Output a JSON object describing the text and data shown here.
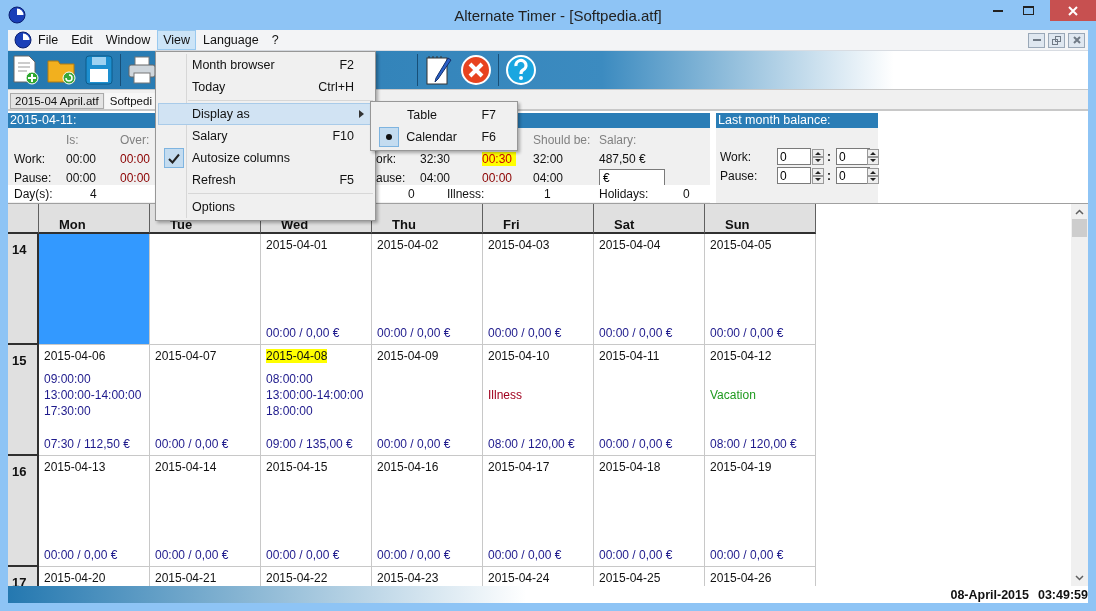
{
  "window": {
    "title": "Alternate Timer - [Softpedia.atf]"
  },
  "menu_bar": [
    {
      "label": "File",
      "selected": false
    },
    {
      "label": "Edit",
      "selected": false
    },
    {
      "label": "Window",
      "selected": false
    },
    {
      "label": "View",
      "selected": true
    },
    {
      "label": "Language",
      "selected": false
    },
    {
      "label": "?",
      "selected": false
    }
  ],
  "file_tabs": [
    {
      "label": "2015-04 April.atf",
      "selected": false
    },
    {
      "label": "Softpedi",
      "selected": true
    }
  ],
  "day_panel": {
    "title": "2015-04-11:",
    "headers": [
      "Is:",
      "Over:"
    ],
    "rows": [
      {
        "label": "Work:",
        "is": "00:00",
        "over": "00:00"
      },
      {
        "label": "Pause:",
        "is": "00:00",
        "over": "00:00"
      }
    ]
  },
  "month_panel": {
    "headers": [
      "Should be:",
      "Salary:"
    ],
    "rows": [
      {
        "label": "ork:",
        "is": "32:30",
        "over": "00:30",
        "over_highlighted": true,
        "should_be": "32:00",
        "salary": {
          "kind": "text",
          "value": "487,50 €"
        }
      },
      {
        "label": "ause:",
        "is": "04:00",
        "over": "00:00",
        "over_highlighted": false,
        "should_be": "04:00",
        "salary": {
          "kind": "field",
          "value": "€"
        }
      }
    ]
  },
  "counts": [
    {
      "label": "Day(s):",
      "value": "4"
    },
    {
      "value": "0"
    },
    {
      "label": "Illness:",
      "value": "1"
    },
    {
      "label": "Holidays:",
      "value": "0"
    }
  ],
  "balance": {
    "title": "Last month balance:",
    "rows": [
      {
        "label": "Work:",
        "hours": "0",
        "separator": ":",
        "minutes": "0"
      },
      {
        "label": "Pause:",
        "hours": "0",
        "separator": ":",
        "minutes": "0"
      }
    ]
  },
  "calendar": {
    "columns": [
      "Mon",
      "Tue",
      "Wed",
      "Thu",
      "Fri",
      "Sat",
      "Sun"
    ],
    "weeks": [
      {
        "week": "14",
        "days": [
          {
            "kind": "blank",
            "selected": true
          },
          {
            "kind": "blank",
            "selected": false
          },
          {
            "kind": "day",
            "date": "2015-04-01",
            "today": false,
            "selected": false,
            "total": "00:00 / 0,00 €"
          },
          {
            "kind": "day",
            "date": "2015-04-02",
            "today": false,
            "selected": false,
            "total": "00:00 / 0,00 €"
          },
          {
            "kind": "day",
            "date": "2015-04-03",
            "today": false,
            "selected": false,
            "total": "00:00 / 0,00 €"
          },
          {
            "kind": "day",
            "date": "2015-04-04",
            "today": false,
            "selected": false,
            "total": "00:00 / 0,00 €"
          },
          {
            "kind": "day",
            "date": "2015-04-05",
            "today": false,
            "selected": false,
            "total": "00:00 / 0,00 €"
          }
        ]
      },
      {
        "week": "15",
        "days": [
          {
            "kind": "day",
            "date": "2015-04-06",
            "today": false,
            "selected": false,
            "times": [
              "09:00:00",
              "13:00:00-14:00:00",
              "17:30:00"
            ],
            "total": "07:30 / 112,50 €"
          },
          {
            "kind": "day",
            "date": "2015-04-07",
            "today": false,
            "selected": false,
            "total": "00:00 / 0,00 €"
          },
          {
            "kind": "day",
            "date": "2015-04-08",
            "today": true,
            "selected": false,
            "times": [
              "08:00:00",
              "13:00:00-14:00:00",
              "18:00:00"
            ],
            "total": "09:00 / 135,00 €"
          },
          {
            "kind": "day",
            "date": "2015-04-09",
            "today": false,
            "selected": false,
            "total": "00:00 / 0,00 €"
          },
          {
            "kind": "day",
            "date": "2015-04-10",
            "today": false,
            "selected": false,
            "note": {
              "kind": "illness",
              "text": "Illness"
            },
            "total": "08:00 / 120,00 €"
          },
          {
            "kind": "day",
            "date": "2015-04-11",
            "today": false,
            "selected": false,
            "total": "00:00 / 0,00 €"
          },
          {
            "kind": "day",
            "date": "2015-04-12",
            "today": false,
            "selected": false,
            "note": {
              "kind": "vacation",
              "text": "Vacation"
            },
            "total": "08:00 / 120,00 €"
          }
        ]
      },
      {
        "week": "16",
        "days": [
          {
            "kind": "day",
            "date": "2015-04-13",
            "today": false,
            "selected": false,
            "total": "00:00 / 0,00 €"
          },
          {
            "kind": "day",
            "date": "2015-04-14",
            "today": false,
            "selected": false,
            "total": "00:00 / 0,00 €"
          },
          {
            "kind": "day",
            "date": "2015-04-15",
            "today": false,
            "selected": false,
            "total": "00:00 / 0,00 €"
          },
          {
            "kind": "day",
            "date": "2015-04-16",
            "today": false,
            "selected": false,
            "total": "00:00 / 0,00 €"
          },
          {
            "kind": "day",
            "date": "2015-04-17",
            "today": false,
            "selected": false,
            "total": "00:00 / 0,00 €"
          },
          {
            "kind": "day",
            "date": "2015-04-18",
            "today": false,
            "selected": false,
            "total": "00:00 / 0,00 €"
          },
          {
            "kind": "day",
            "date": "2015-04-19",
            "today": false,
            "selected": false,
            "total": "00:00 / 0,00 €"
          }
        ]
      },
      {
        "week": "17",
        "days": [
          {
            "kind": "day",
            "date": "2015-04-20",
            "today": false,
            "selected": false
          },
          {
            "kind": "day",
            "date": "2015-04-21",
            "today": false,
            "selected": false
          },
          {
            "kind": "day",
            "date": "2015-04-22",
            "today": false,
            "selected": false
          },
          {
            "kind": "day",
            "date": "2015-04-23",
            "today": false,
            "selected": false
          },
          {
            "kind": "day",
            "date": "2015-04-24",
            "today": false,
            "selected": false
          },
          {
            "kind": "day",
            "date": "2015-04-25",
            "today": false,
            "selected": false
          },
          {
            "kind": "day",
            "date": "2015-04-26",
            "today": false,
            "selected": false
          }
        ]
      }
    ]
  },
  "view_menu": {
    "items": [
      {
        "kind": "item",
        "label": "Month browser",
        "shortcut": "F2",
        "selected": false,
        "checked": false,
        "submenu": false
      },
      {
        "kind": "item",
        "label": "Today",
        "shortcut": "Ctrl+H",
        "selected": false,
        "checked": false,
        "submenu": false
      },
      {
        "kind": "separator"
      },
      {
        "kind": "item",
        "label": "Display as",
        "selected": true,
        "checked": false,
        "submenu": true
      },
      {
        "kind": "item",
        "label": "Salary",
        "shortcut": "F10",
        "selected": false,
        "checked": false,
        "submenu": false
      },
      {
        "kind": "item",
        "label": "Autosize columns",
        "selected": false,
        "checked": true,
        "submenu": false
      },
      {
        "kind": "item",
        "label": "Refresh",
        "shortcut": "F5",
        "selected": false,
        "checked": false,
        "submenu": false
      },
      {
        "kind": "separator"
      },
      {
        "kind": "item",
        "label": "Options",
        "selected": false,
        "checked": false,
        "submenu": false
      }
    ]
  },
  "display_submenu": {
    "items": [
      {
        "label": "Table",
        "shortcut": "F7",
        "selected": false
      },
      {
        "label": "Calendar",
        "shortcut": "F6",
        "selected": true
      }
    ]
  },
  "status_bar": {
    "date": "08-April-2015",
    "time": "03:49:59"
  }
}
